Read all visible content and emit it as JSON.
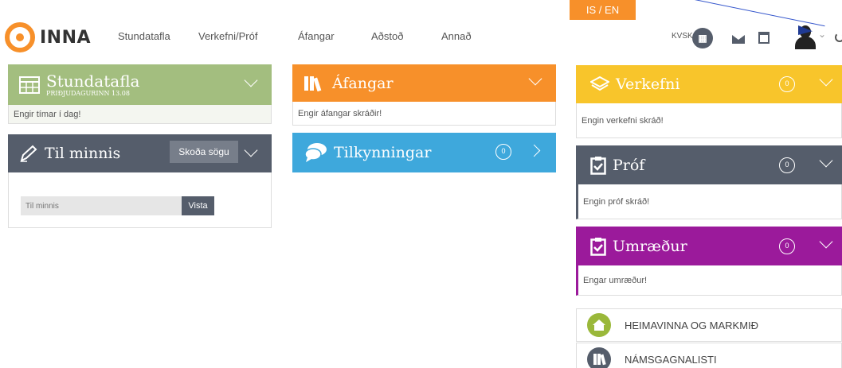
{
  "language_switch": "IS / EN",
  "logo_text": "INNA",
  "nav": [
    {
      "label": "Stundatafla"
    },
    {
      "label": "Verkefni/Próf"
    },
    {
      "label": "Áfangar"
    },
    {
      "label": "Aðstoð"
    },
    {
      "label": "Annað"
    }
  ],
  "header": {
    "school_code": "KVSK",
    "school_badge": "▦"
  },
  "timetable": {
    "title": "Stundatafla",
    "subtitle": "PRIÐJUDAGURINN 13.08",
    "body": "Engir tímar í dag!",
    "color": "#a3be7f"
  },
  "reminders": {
    "title": "Til minnis",
    "history_button": "Skoða sögu",
    "input_placeholder": "Til minnis",
    "save_button": "Vista",
    "color": "#555d6b"
  },
  "courses": {
    "title": "Áfangar",
    "body": "Engir áfangar skráðir!",
    "color": "#f7902a"
  },
  "announcements": {
    "title": "Tilkynningar",
    "count": "0",
    "color": "#3ea8dc"
  },
  "assignments": {
    "title": "Verkefni",
    "count": "0",
    "body": "Engin verkefni skráð!",
    "color": "#f8c52b"
  },
  "exams": {
    "title": "Próf",
    "count": "0",
    "body": "Engin próf skráð!",
    "color": "#555d6b"
  },
  "discussions": {
    "title": "Umræður",
    "count": "0",
    "body": "Engar umræður!",
    "color": "#9b1a9b"
  },
  "links": [
    {
      "label": "HEIMAVINNA OG MARKMIÐ",
      "color": "#9ab83a"
    },
    {
      "label": "NÁMSGAGNALISTI",
      "color": "#555d6b"
    }
  ]
}
